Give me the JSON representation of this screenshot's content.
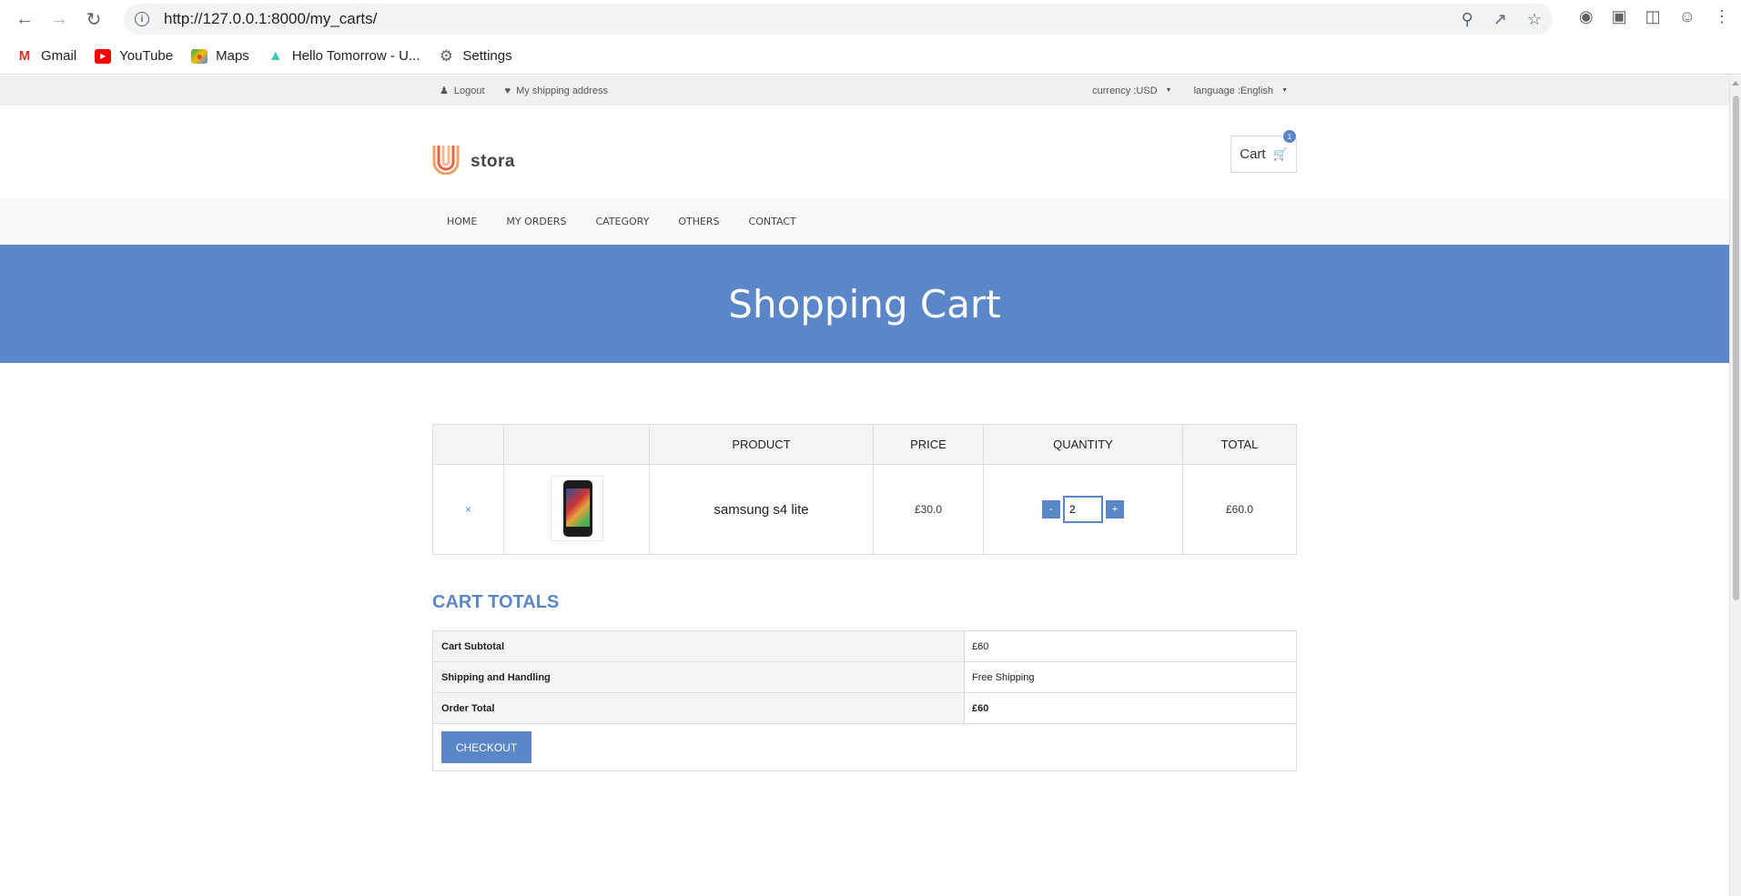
{
  "browser": {
    "url": "http://127.0.0.1:8000/my_carts/",
    "bookmarks": [
      {
        "label": "Gmail",
        "icon": "gmail-icon"
      },
      {
        "label": "YouTube",
        "icon": "youtube-icon"
      },
      {
        "label": "Maps",
        "icon": "maps-icon"
      },
      {
        "label": "Hello Tomorrow - U...",
        "icon": "hello-tomorrow-icon"
      },
      {
        "label": "Settings",
        "icon": "gear-icon"
      }
    ]
  },
  "topbar": {
    "logout": "Logout",
    "shipping": "My shipping address",
    "currency": "currency :USD",
    "language": "language :English"
  },
  "header": {
    "logo_text": "stora",
    "cart_label": "Cart",
    "cart_count": "1"
  },
  "nav": {
    "items": [
      "HOME",
      "MY ORDERS",
      "CATEGORY",
      "OTHERS",
      "CONTACT"
    ]
  },
  "banner": {
    "title": "Shopping Cart"
  },
  "cart": {
    "headers": [
      "",
      "",
      "PRODUCT",
      "PRICE",
      "QUANTITY",
      "TOTAL"
    ],
    "items": [
      {
        "remove": "×",
        "name": "samsung s4 lite",
        "price": "£30.0",
        "quantity": "2",
        "total": "£60.0",
        "minus": "-",
        "plus": "+"
      }
    ]
  },
  "totals": {
    "title": "CART TOTALS",
    "rows": [
      {
        "label": "Cart Subtotal",
        "value": "£60"
      },
      {
        "label": "Shipping and Handling",
        "value": "Free Shipping"
      },
      {
        "label": "Order Total",
        "value": "£60"
      }
    ],
    "checkout": "CHECKOUT"
  },
  "colors": {
    "accent": "#5b87c9",
    "topbar_bg": "#f0f0f0"
  }
}
